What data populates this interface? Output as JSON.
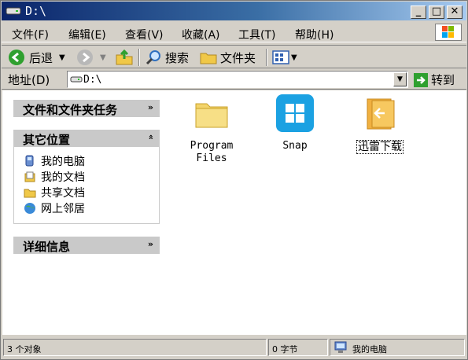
{
  "window": {
    "title": "D:\\"
  },
  "menu": {
    "items": [
      {
        "label": "文件(F)"
      },
      {
        "label": "编辑(E)"
      },
      {
        "label": "查看(V)"
      },
      {
        "label": "收藏(A)"
      },
      {
        "label": "工具(T)"
      },
      {
        "label": "帮助(H)"
      }
    ]
  },
  "toolbar": {
    "back_label": "后退",
    "search_label": "搜索",
    "folders_label": "文件夹"
  },
  "address": {
    "label": "地址(D)",
    "value": "D:\\",
    "go_label": "转到"
  },
  "sidebar": {
    "tasks_title": "文件和文件夹任务",
    "places_title": "其它位置",
    "places": [
      {
        "label": "我的电脑",
        "icon": "computer-icon"
      },
      {
        "label": "我的文档",
        "icon": "documents-icon"
      },
      {
        "label": "共享文档",
        "icon": "shared-folder-icon"
      },
      {
        "label": "网上邻居",
        "icon": "network-icon"
      }
    ],
    "details_title": "详细信息"
  },
  "files": [
    {
      "label": "Program Files",
      "icon": "folder-icon"
    },
    {
      "label": "Snap",
      "icon": "windows-snap-icon"
    },
    {
      "label": "迅雷下载",
      "icon": "download-folder-icon",
      "selected": true
    }
  ],
  "status": {
    "objects": "3 个对象",
    "size": "0 字节",
    "location": "我的电脑"
  },
  "colors": {
    "title_gradient_start": "#0a246a",
    "title_gradient_end": "#a6caf0",
    "panel_header": "#c9c9c9",
    "snap_blue": "#1ba1e2"
  }
}
